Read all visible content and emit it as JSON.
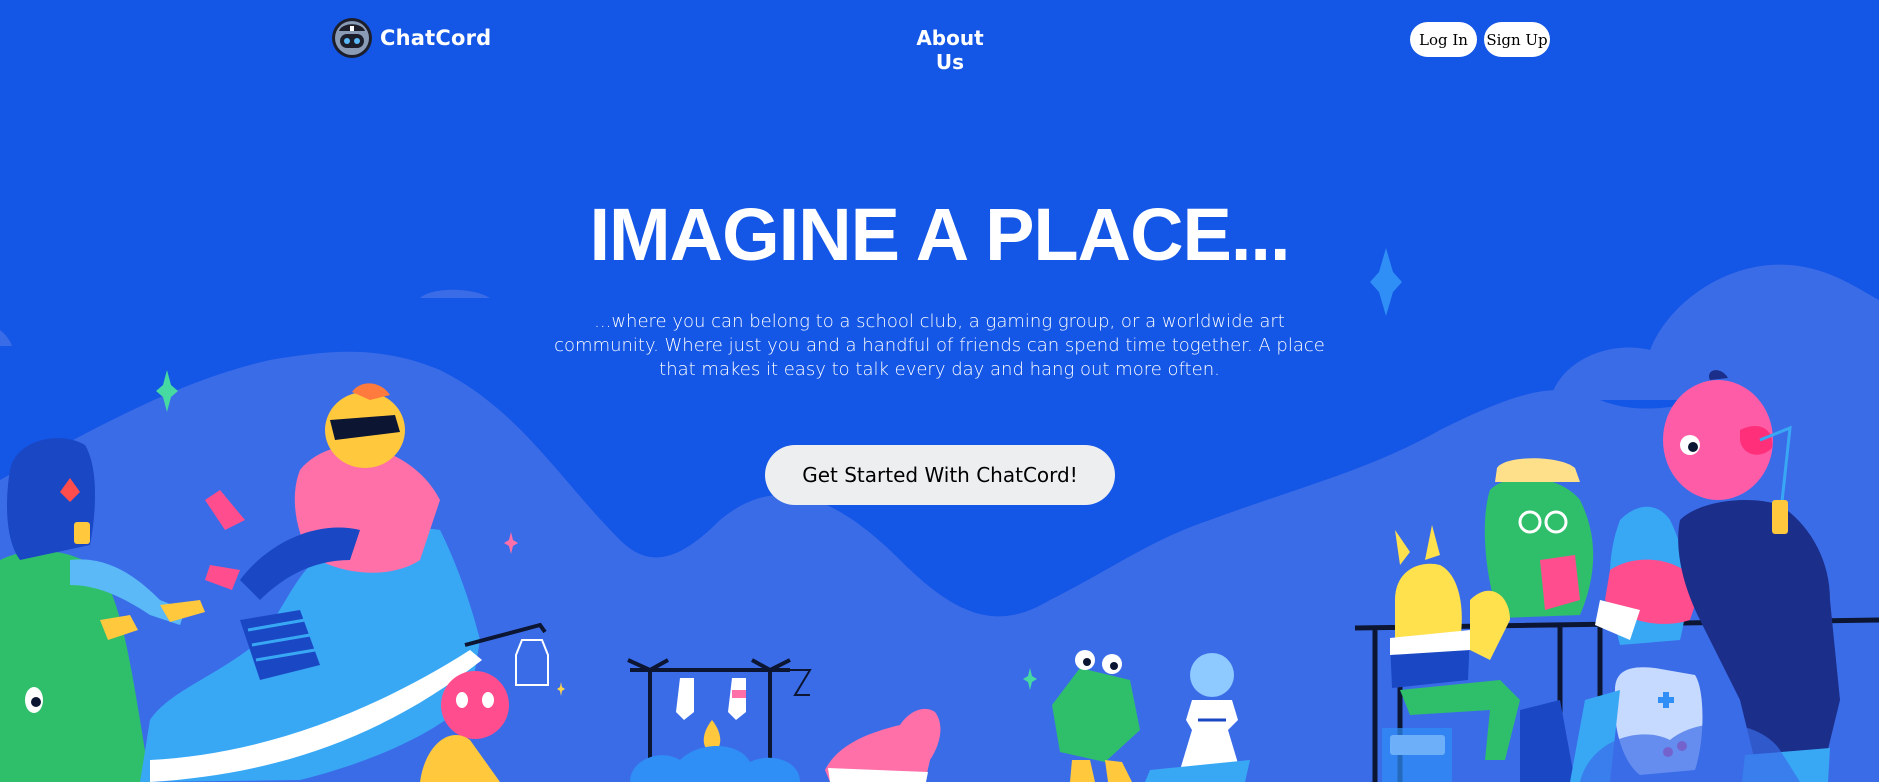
{
  "nav": {
    "logo_text": "ChatCord",
    "about_label": "About Us",
    "login_label": "Log In",
    "signup_label": "Sign Up"
  },
  "hero": {
    "title": "IMAGINE A PLACE...",
    "subtitle": "...where you can belong to a school club, a gaming group, or a worldwide art community. Where just you and a handful of friends can spend time together. A place that makes it easy to talk every day and hang out more often.",
    "cta_label": "Get Started With ChatCord!"
  },
  "colors": {
    "background": "#1456e5",
    "hills": "#3b6ce8",
    "button_bg": "#eceef0",
    "text": "#ffffff"
  },
  "icons": {
    "logo": "robot-helmet-icon",
    "sparkles": "sparkle-icon"
  }
}
